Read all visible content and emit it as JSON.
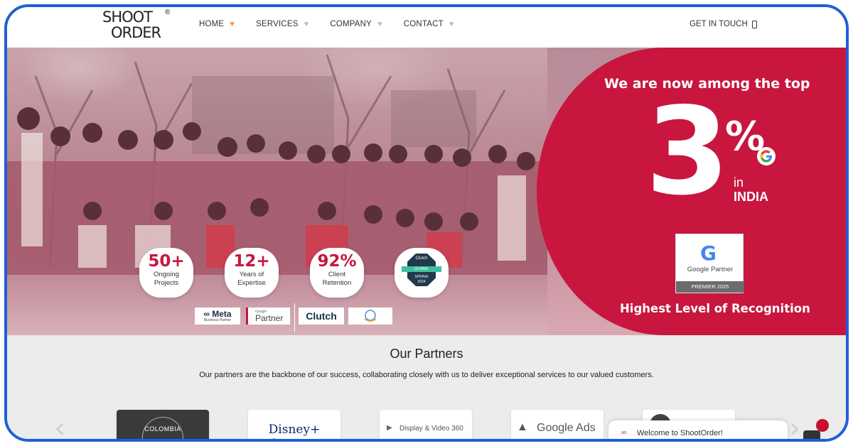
{
  "brand": {
    "logo_line1": "SHOOT",
    "logo_line2": "ORDER",
    "registered": "®"
  },
  "nav": {
    "items": [
      {
        "label": "HOME",
        "active": true
      },
      {
        "label": "SERVICES",
        "active": false
      },
      {
        "label": "COMPANY",
        "active": false
      },
      {
        "label": "CONTACT",
        "active": false
      }
    ],
    "cta": "GET IN TOUCH"
  },
  "hero": {
    "promo_heading": "We are now among the top",
    "big_number": "3",
    "percent": "%",
    "in_label": "in",
    "country": "INDIA",
    "partner_card": {
      "label": "Google Partner",
      "tier": "PREMIER 2025"
    },
    "recognition": "Highest Level of Recognition",
    "stats": [
      {
        "value": "50+",
        "label_line1": "Ongoing",
        "label_line2": "Projects"
      },
      {
        "value": "12+",
        "label_line1": "Years of",
        "label_line2": "Expertise"
      },
      {
        "value": "92%",
        "label_line1": "Client",
        "label_line2": "Retention"
      }
    ],
    "clutch_badge": {
      "top": "Clutch",
      "ribbon": "GLOBAL",
      "season": "SPRING",
      "year": "2024"
    },
    "badges": [
      {
        "label": "∞ Meta",
        "sub": "Business Partner"
      },
      {
        "label": "Partner",
        "sub": "Google"
      },
      {
        "label": "Clutch",
        "sub": ""
      },
      {
        "label": "",
        "sub": ""
      }
    ]
  },
  "partners": {
    "title": "Our Partners",
    "subtitle": "Our partners are the backbone of our success, collaborating closely with us to deliver exceptional services to our valued customers.",
    "logos": [
      "COLOMBIA",
      "Disney+ hotstar",
      "Display & Video 360",
      "Google Ads",
      ""
    ]
  },
  "chat": {
    "text": "Welcome to ShootOrder!"
  },
  "colors": {
    "brand_red": "#c8163e",
    "accent_orange": "#f59a1b",
    "frame_blue": "#1f5fd6"
  }
}
